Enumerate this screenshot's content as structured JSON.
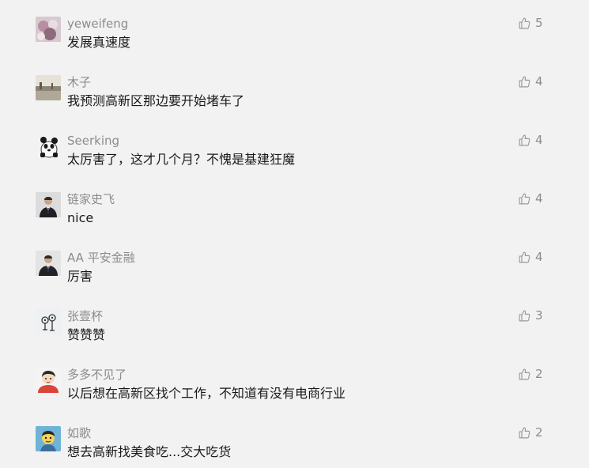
{
  "comments": [
    {
      "username": "yeweifeng",
      "content": "发展真速度",
      "likes": "5",
      "avatar": "flowers-photo-avatar"
    },
    {
      "username": "木子",
      "content": "我预测高新区那边要开始堵车了",
      "likes": "4",
      "avatar": "landscape-photo-avatar"
    },
    {
      "username": "Seerking",
      "content": "太厉害了，这才几个月？不愧是基建狂魔",
      "likes": "4",
      "avatar": "panda-avatar"
    },
    {
      "username": "链家史飞",
      "content": "nice",
      "likes": "4",
      "avatar": "man-in-suit-avatar"
    },
    {
      "username": "AA 平安金融",
      "content": "厉害",
      "likes": "4",
      "avatar": "man-in-suit-avatar"
    },
    {
      "username": "张壹杯",
      "content": "赞赞赞",
      "likes": "3",
      "avatar": "sketch-drawing-avatar"
    },
    {
      "username": "多多不见了",
      "content": "以后想在高新区找个工作，不知道有没有电商行业",
      "likes": "2",
      "avatar": "cartoon-boy-avatar"
    },
    {
      "username": "如歌",
      "content": "想去高新找美食吃...交大吃货",
      "likes": "2",
      "avatar": "cartoon-character-avatar"
    }
  ],
  "icons": {
    "like": "thumbs-up-icon"
  },
  "colors": {
    "background": "#f2f2f2",
    "username": "#8c8c8c",
    "content": "#1a1a1a",
    "icon": "#9a9a9a"
  }
}
